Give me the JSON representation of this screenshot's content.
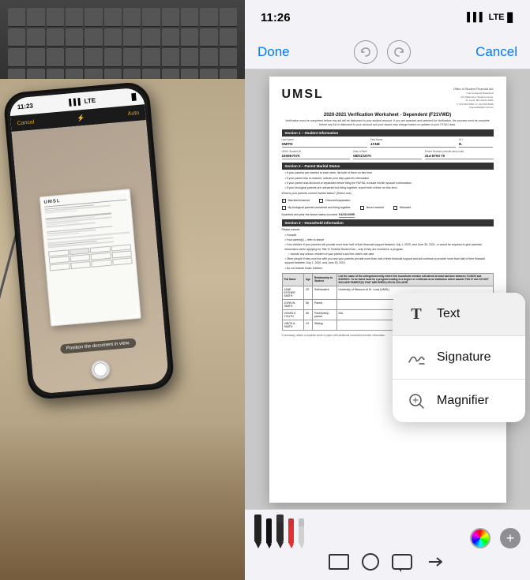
{
  "left_panel": {
    "phone_topbar": {
      "time": "11:23",
      "cancel_label": "Cancel",
      "auto_label": "Auto"
    },
    "scanner": {
      "position_hint": "Position the document in view."
    },
    "keyboard_visible": true
  },
  "right_panel": {
    "ios_status": {
      "time": "11:26",
      "signal_label": "LTE",
      "battery": "■"
    },
    "topbar": {
      "done_label": "Done",
      "cancel_label": "Cancel"
    },
    "document": {
      "logo": "UMSL",
      "office_name": "Office of Student Financial Aid",
      "office_address": "One University Boulevard\n227 Millennium Student Center\nSt. Louis, MO 63121-4400\nT: 314-516-5526 / F: 314-516-5408\nfinancialaid@umsl.edu / umsl.edu/financialaid",
      "title": "2020-2021 Verification Worksheet - Dependent (F21VWD)",
      "subtitle": "Verification must be completed before any aid will be disbursed to your student account. If you are awarded and selected for Verification, the process must be complete before any Aid is disbursed to your account and your award may change based on updates in your F1SA1 data.",
      "section1_title": "Section 1 – Student Information",
      "fields": {
        "last_name_label": "Last Name",
        "last_name_value": "SMITH",
        "first_name_label": "First Name",
        "first_name_value": "JANE",
        "mi_label": "M.I.",
        "mi_value": "E.",
        "student_id_label": "UMSL Student ID",
        "student_id_value": "1930E7070",
        "dob_label": "Date of Birth",
        "dob_value": "08/01/1970",
        "phone_label": "Phone Number (include area code)",
        "phone_value": "314-8700 70"
      },
      "section2_title": "Section 2 – Parent Marital Status",
      "section2_bullets": [
        "If your parents are married to each other, list both of them on this form",
        "If your parent has re-married, include your step-parent's information",
        "If your parent was divorced or separated before filing the FAFSA, exclude his/her spouse's information",
        "If your biological parents are unmarried but living together, report both of them on this form"
      ],
      "marital_question": "What is your parent's current marital status? (Select one)",
      "marital_options": [
        {
          "label": "Married/remarried",
          "checked": true
        },
        {
          "label": "Divorced/separated",
          "checked": false
        },
        {
          "label": "My biological parents unmarried and living together",
          "checked": false
        },
        {
          "label": "Never married",
          "checked": false
        },
        {
          "label": "Widowed",
          "checked": false
        }
      ],
      "marital_date_label": "If parents and year the above status occurred:",
      "marital_date_value": "01/21/1995",
      "section3_title": "Section 3 – Household Information",
      "section3_intro": "Please include:",
      "section3_bullets": [
        "Yourself",
        "Your parent(s) – refer to above",
        "Your children if your parents will provide more than half of their financial support between July 1, 2020, and June 30, 2021, or would be required to give parental information when applying for Title IV Federal Student Aid – only if they are enrolled in a program",
        "Include any unborn children of your parent's and the child's due date",
        "Other people if they now live with you and your parents provide more than half of their financial support and will continue to provide more than half of their financial support between July 1, 2020, and June 30, 2021.",
        "Do not include foster children."
      ],
      "table_headers": [
        "Full Name",
        "Age",
        "Relationship to Student",
        "List the name of the college/university where this household member will attend at least half-time between 7/1/2020 and 6/30/2021. To be listed must be a program leading to a degree or certificate at an institution which awards Title IV aid. DO NOT INCLUDE PARENT(S) THAT ARE ENROLLED IN COLLEGE."
      ],
      "table_rows": [
        [
          "JANE ESTHER SMITH",
          "20",
          "Self/student",
          "University of Missouri at St. Louis (UMSL)"
        ],
        [
          "JOHN W. SMITH",
          "56",
          "Parent",
          ""
        ],
        [
          "VIVIAN K. YOUTH",
          "56",
          "Parent/step-parent",
          "N/A"
        ],
        [
          "VINCE A. SMITH",
          "13",
          "Sibling",
          ""
        ]
      ],
      "footer_note": "If necessary, attach a separate sheet of paper with additional household member information."
    },
    "popup_menu": {
      "items": [
        {
          "label": "Text",
          "icon": "T",
          "icon_type": "text"
        },
        {
          "label": "Signature",
          "icon": "✍",
          "icon_type": "signature"
        },
        {
          "label": "Magnifier",
          "icon": "🔍",
          "icon_type": "magnifier"
        }
      ]
    },
    "bottom_toolbar": {
      "shape_tools": [
        "rectangle",
        "circle",
        "speech-bubble",
        "arrow"
      ],
      "color_wheel_label": "color-picker",
      "add_button_label": "+",
      "pens": [
        {
          "color_cap": "#1a1a1a",
          "color_body": "#2a2a2a",
          "tip_color": "#1a1a1a",
          "thick": false
        },
        {
          "color_cap": "#1a1a1a",
          "color_body": "#1a1a1a",
          "tip_color": "#1a1a1a",
          "thick": true
        },
        {
          "color_cap": "#1a1a1a",
          "color_body": "#1a1a1a",
          "tip_color": "#1a1a1a",
          "thick": false
        },
        {
          "color_cap": "#e83030",
          "color_body": "#e83030",
          "tip_color": "#e83030",
          "thick": false
        },
        {
          "color_cap": "#e0e0e0",
          "color_body": "#c8c8c8",
          "tip_color": "#c8c8c8",
          "thick": false
        }
      ]
    }
  }
}
